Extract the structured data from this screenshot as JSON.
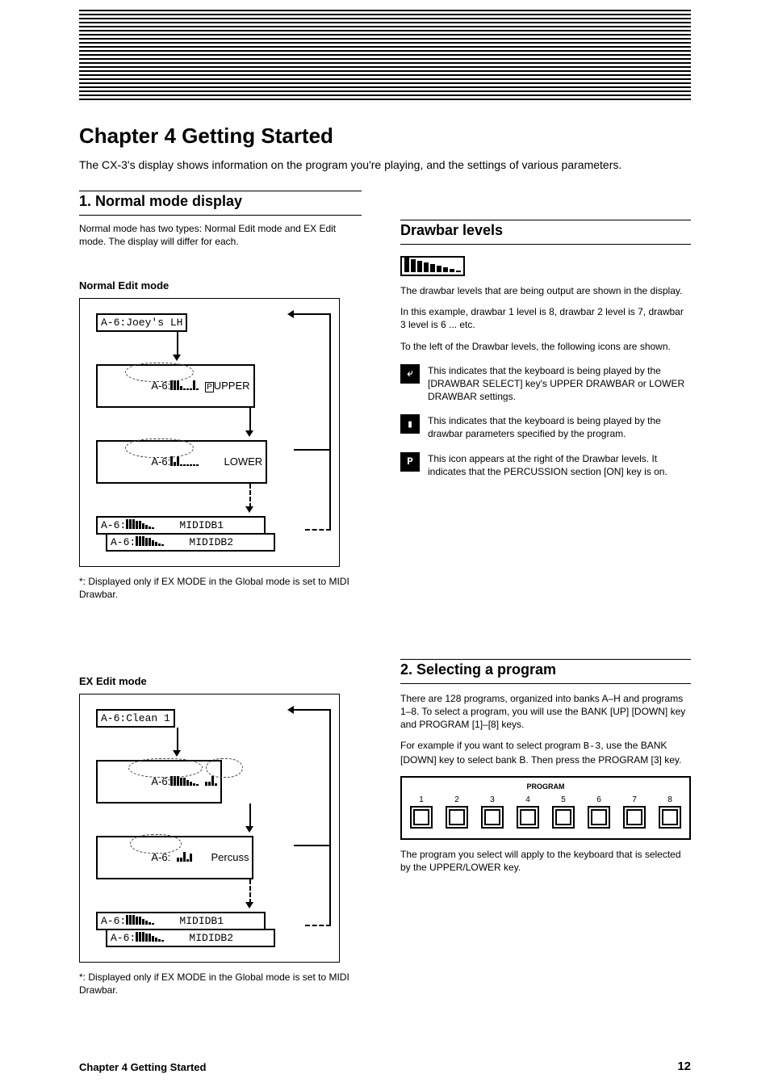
{
  "header_title": "Chapter 4 Getting Started",
  "intro": "The CX-3's display shows information on the program you're playing, and the settings of various parameters.",
  "left": {
    "h2": "1. Normal mode display",
    "p1": "Normal mode has two types: Normal Edit mode and EX Edit mode. The display will differ for each.",
    "sub1": "Normal Edit mode",
    "d1_note": "*: Displayed only if EX MODE in the Global mode is set to MIDI Drawbar.",
    "sub2": "EX Edit mode",
    "d2_note": "*: Displayed only if EX MODE in the Global mode is set to MIDI Drawbar.",
    "lcd": {
      "a": "A-6:Joey's LH",
      "b": "A-6:",
      "b_tag": "UPPER",
      "b_percg": "P",
      "c": "A-6:",
      "c_tag": "LOWER",
      "m1": "A-6:           MIDIDB1",
      "m2": "A-6:           MIDIDB2",
      "ex_a": "A-6:Clean 1",
      "ex_b": "A-6:",
      "ex_c": "A-6:",
      "ex_c_tag": "Percuss"
    }
  },
  "right": {
    "h2a": "Drawbar levels",
    "pA": "The drawbar levels that are being output are shown in the display.",
    "pA_example": "In this example, drawbar 1 level is 8, drawbar 2 level is 7, drawbar 3 level is 6 ... etc.",
    "pB": "To the left of the Drawbar levels, the following icons are shown.",
    "icon1_txt": "This indicates that the keyboard is being played by the [DRAWBAR SELECT] key's UPPER DRAWBAR or LOWER DRAWBAR settings.",
    "icon2_txt": "This indicates that the keyboard is being played by the drawbar parameters specified by the program.",
    "icon3_txt": "This icon appears at the right of the Drawbar levels. It indicates that the PERCUSSION section [ON] key is on.",
    "h2b": "2. Selecting a program",
    "pS1": "There are 128 programs, organized into banks A–H and programs 1–8. To select a program, you will use the BANK [UP] [DOWN] key and PROGRAM [1]–[8] keys.",
    "pS2_pre": "For example if you want to select program ",
    "pS2_code": "B-3",
    "pS2_post": ", use the BANK [DOWN] key to select bank B. Then press the PROGRAM [3] key.",
    "proglabel": "PROGRAM",
    "prognums": [
      "1",
      "2",
      "3",
      "4",
      "5",
      "6",
      "7",
      "8"
    ],
    "pS3": "The program you select will apply to the keyboard that is selected by the UPPER/LOWER key."
  },
  "footer": "Chapter 4 Getting Started",
  "page_no": "12"
}
